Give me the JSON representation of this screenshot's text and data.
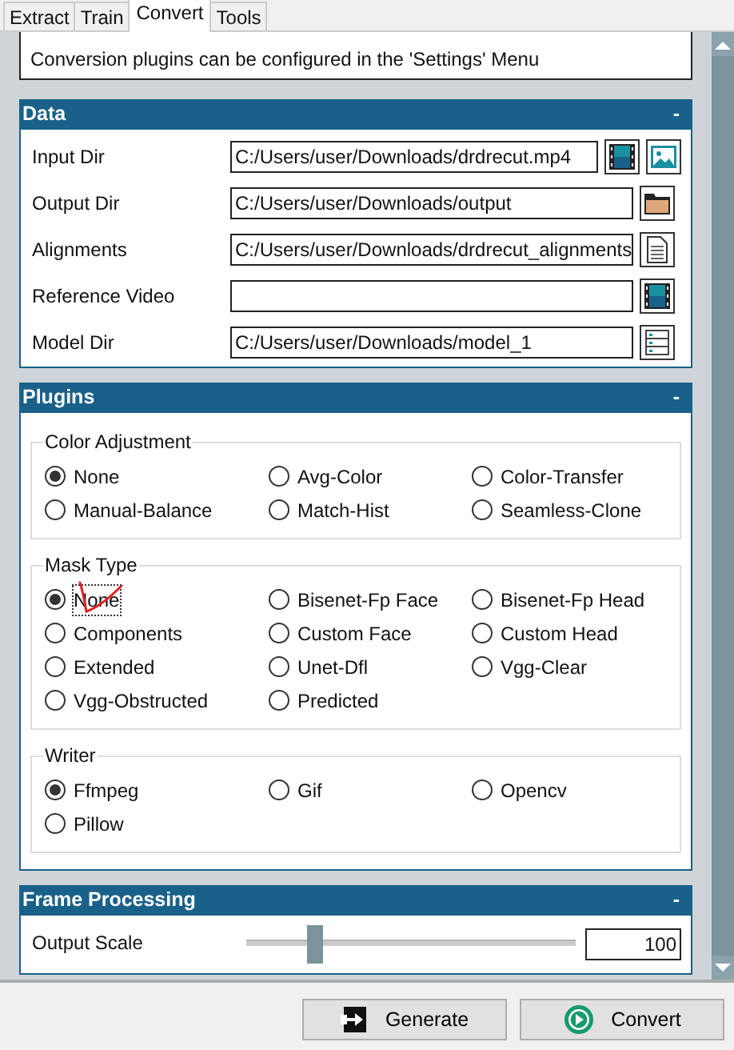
{
  "tabs": [
    {
      "label": "Extract",
      "selected": false
    },
    {
      "label": "Train",
      "selected": false
    },
    {
      "label": "Convert",
      "selected": true
    },
    {
      "label": "Tools",
      "selected": false
    }
  ],
  "info": "Conversion plugins can be configured in the 'Settings' Menu",
  "sections": [
    {
      "title": "Data",
      "toggle": "-",
      "kind": "fields",
      "fields": [
        {
          "label": "Input Dir",
          "value": "C:/Users/user/Downloads/drdrecut.mp4",
          "icons": [
            {
              "kind": "film"
            },
            {
              "kind": "image"
            }
          ]
        },
        {
          "label": "Output Dir",
          "value": "C:/Users/user/Downloads/output",
          "icons": [
            {
              "kind": "folder"
            }
          ]
        },
        {
          "label": "Alignments",
          "value": "C:/Users/user/Downloads/drdrecut_alignments",
          "icons": [
            {
              "kind": "document"
            }
          ]
        },
        {
          "label": "Reference Video",
          "icons": [
            {
              "kind": "film"
            }
          ]
        },
        {
          "label": "Model Dir",
          "value": "C:/Users/user/Downloads/model_1",
          "icons": [
            {
              "kind": "list"
            }
          ]
        }
      ]
    },
    {
      "title": "Plugins",
      "toggle": "-",
      "kind": "groups",
      "groups": [
        {
          "title": "Color Adjustment",
          "options": [
            {
              "label": "None",
              "selected": true
            },
            {
              "label": "Avg-Color",
              "selected": false
            },
            {
              "label": "Color-Transfer",
              "selected": false
            },
            {
              "label": "Manual-Balance",
              "selected": false
            },
            {
              "label": "Match-Hist",
              "selected": false
            },
            {
              "label": "Seamless-Clone",
              "selected": false
            }
          ]
        },
        {
          "title": "Mask Type",
          "options": [
            {
              "label": "None",
              "selected": true
            },
            {
              "label": "Bisenet-Fp Face",
              "selected": false
            },
            {
              "label": "Bisenet-Fp Head",
              "selected": false
            },
            {
              "label": "Components",
              "selected": false
            },
            {
              "label": "Custom Face",
              "selected": false
            },
            {
              "label": "Custom Head",
              "selected": false
            },
            {
              "label": "Extended",
              "selected": false
            },
            {
              "label": "Unet-Dfl",
              "selected": false
            },
            {
              "label": "Vgg-Clear",
              "selected": false
            },
            {
              "label": "Vgg-Obstructed",
              "selected": false
            },
            {
              "label": "Predicted",
              "selected": false
            }
          ]
        },
        {
          "title": "Writer",
          "options": [
            {
              "label": "Ffmpeg",
              "selected": true
            },
            {
              "label": "Gif",
              "selected": false
            },
            {
              "label": "Opencv",
              "selected": false
            },
            {
              "label": "Pillow",
              "selected": false
            }
          ]
        }
      ]
    },
    {
      "title": "Frame Processing",
      "toggle": "-",
      "kind": "sliders",
      "sliders": [
        {
          "label": "Output Scale",
          "level": 0.21,
          "value": "100"
        }
      ]
    }
  ],
  "buttons": [
    {
      "label": "Generate",
      "kind": "generate"
    },
    {
      "label": "Convert",
      "kind": "convert"
    }
  ]
}
